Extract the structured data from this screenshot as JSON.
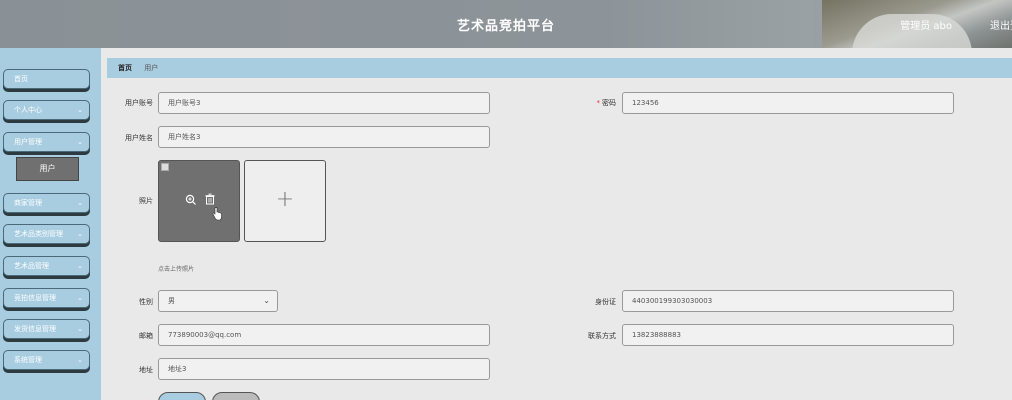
{
  "header": {
    "title": "艺术品竞拍平台",
    "user": "管理员 abo",
    "logout": "退出登录"
  },
  "sidebar": {
    "items": [
      {
        "label": "首页",
        "chevron": ""
      },
      {
        "label": "个人中心",
        "chevron": "⌄"
      },
      {
        "label": "用户管理",
        "chevron": "⌄"
      },
      {
        "label": "商家管理",
        "chevron": "⌄"
      },
      {
        "label": "艺术品类别管理",
        "chevron": "⌄"
      },
      {
        "label": "艺术品管理",
        "chevron": "⌄"
      },
      {
        "label": "竞拍信息管理",
        "chevron": "⌄"
      },
      {
        "label": "发货信息管理",
        "chevron": "⌄"
      },
      {
        "label": "系统管理",
        "chevron": "⌄"
      }
    ],
    "sub_item": "用户"
  },
  "breadcrumb": {
    "home": "首页",
    "current": "用户"
  },
  "form": {
    "account": {
      "label": "用户账号",
      "value": "用户账号3"
    },
    "password": {
      "required": "*",
      "label": "密码",
      "value": "123456"
    },
    "name": {
      "label": "用户姓名",
      "value": "用户姓名3"
    },
    "photo": {
      "label": "照片",
      "hint": "点击上传照片",
      "add_symbol": "+"
    },
    "gender": {
      "label": "性别",
      "value": "男",
      "chevron": "⌄"
    },
    "id_card": {
      "label": "身份证",
      "value": "440300199303030003"
    },
    "email": {
      "label": "邮箱",
      "value": "773890003@qq.com"
    },
    "phone": {
      "label": "联系方式",
      "value": "13823888883"
    },
    "address": {
      "label": "地址",
      "value": "地址3"
    }
  },
  "icons": {
    "zoom": "zoom-in-icon",
    "trash": "trash-icon",
    "plus": "plus-icon"
  },
  "colors": {
    "accent": "#a8cde1",
    "header": "#8a9196"
  }
}
